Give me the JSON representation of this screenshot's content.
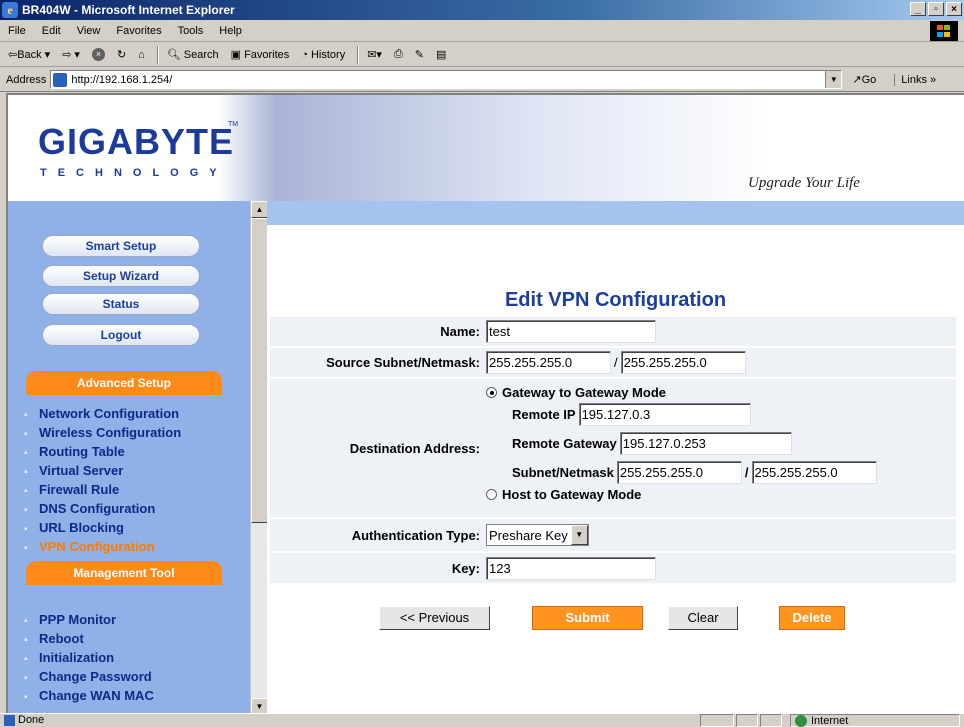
{
  "window": {
    "title": "BR404W - Microsoft Internet Explorer"
  },
  "menu": [
    "File",
    "Edit",
    "View",
    "Favorites",
    "Tools",
    "Help"
  ],
  "toolbar": {
    "back": "⇦Back",
    "search": "Search",
    "favorites": "Favorites",
    "history": "History"
  },
  "address": {
    "label": "Address",
    "url": "http://192.168.1.254/",
    "go": "Go",
    "links": "Links »"
  },
  "header": {
    "logo": "GIGABYTE",
    "logo_sub": "TECHNOLOGY",
    "tagline": "Upgrade Your Life",
    "tm": "TM"
  },
  "sidebar": {
    "buttons": [
      "Smart Setup",
      "Setup Wizard",
      "Status",
      "Logout"
    ],
    "advanced_title": "Advanced Setup",
    "advanced_items": [
      "Network Configuration",
      "Wireless Configuration",
      "Routing Table",
      "Virtual Server",
      "Firewall Rule",
      "DNS Configuration",
      "URL Blocking",
      "VPN Configuration"
    ],
    "management_title": "Management Tool",
    "management_items": [
      "PPP Monitor",
      "Reboot",
      "Initialization",
      "Change Password",
      "Change WAN MAC"
    ]
  },
  "page": {
    "title": "Edit VPN Configuration",
    "name_label": "Name:",
    "name_value": "test",
    "source_label": "Source Subnet/Netmask:",
    "source_subnet": "255.255.255.0",
    "source_netmask": "255.255.255.0",
    "slash": "/",
    "dest_label": "Destination Address:",
    "mode_gateway": "Gateway to Gateway Mode",
    "remote_ip_label": "Remote IP",
    "remote_ip": "195.127.0.3",
    "remote_gw_label": "Remote Gateway",
    "remote_gw": "195.127.0.253",
    "subnet_label": "Subnet/Netmask",
    "dest_subnet": "255.255.255.0",
    "dest_netmask": "255.255.255.0",
    "mode_host": "Host to Gateway Mode",
    "auth_label": "Authentication Type:",
    "auth_value": "Preshare Key",
    "key_label": "Key:",
    "key_value": "123",
    "btn_previous": "<< Previous",
    "btn_submit": "Submit",
    "btn_clear": "Clear",
    "btn_delete": "Delete"
  },
  "status": {
    "left": "Done",
    "zone": "Internet"
  },
  "colors": {
    "title_text": "#1b3f9a",
    "sidebar_bg": "#8fb1e8",
    "accent": "#ff8a1a",
    "active_link": "#ff7a00"
  }
}
